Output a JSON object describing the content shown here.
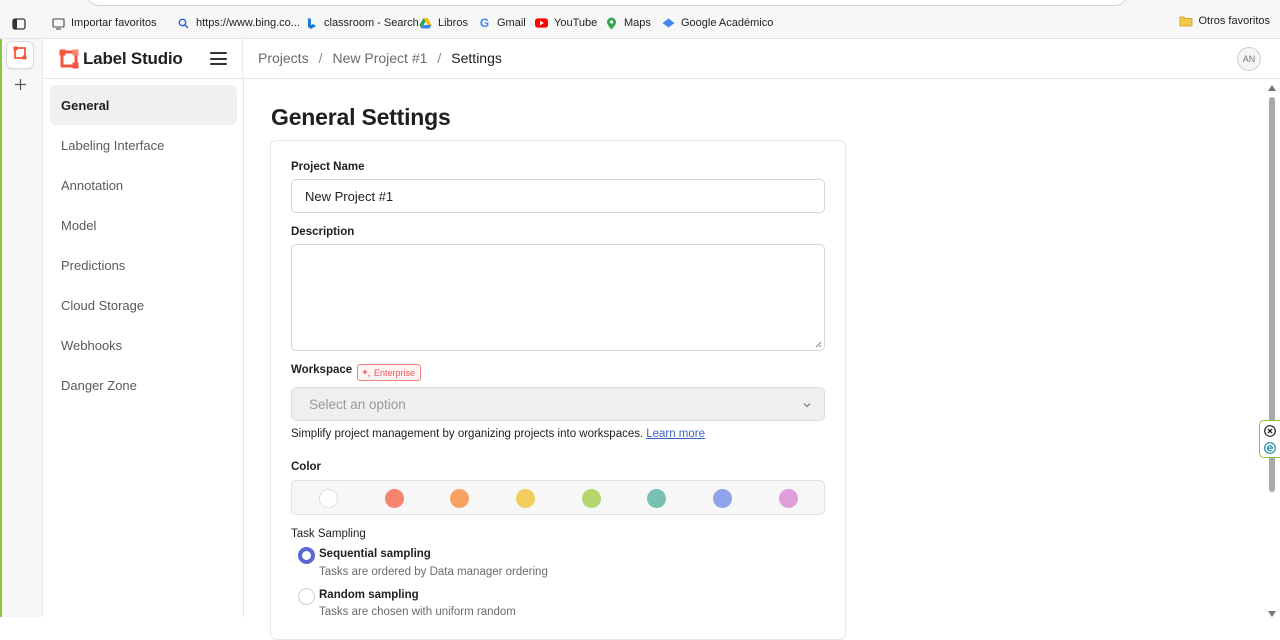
{
  "favorites": {
    "items": [
      {
        "label": "Importar favoritos",
        "icon": "import-icon"
      },
      {
        "label": "https://www.bing.co...",
        "icon": "search-icon"
      },
      {
        "label": "classroom - Search",
        "icon": "bing-icon"
      },
      {
        "label": "Libros",
        "icon": "google-drive-icon"
      },
      {
        "label": "Gmail",
        "icon": "google-icon"
      },
      {
        "label": "YouTube",
        "icon": "youtube-icon"
      },
      {
        "label": "Maps",
        "icon": "maps-pin-icon"
      },
      {
        "label": "Google Académico",
        "icon": "scholar-icon"
      }
    ],
    "other_label": "Otros favoritos"
  },
  "app": {
    "name": "Label Studio",
    "brand_color": "#f5553d"
  },
  "breadcrumb": {
    "items": [
      "Projects",
      "New Project #1",
      "Settings"
    ],
    "separator": "/"
  },
  "user": {
    "initials": "AN"
  },
  "nav": {
    "items": [
      {
        "label": "General",
        "active": true
      },
      {
        "label": "Labeling Interface"
      },
      {
        "label": "Annotation"
      },
      {
        "label": "Model"
      },
      {
        "label": "Predictions"
      },
      {
        "label": "Cloud Storage"
      },
      {
        "label": "Webhooks"
      },
      {
        "label": "Danger Zone"
      }
    ]
  },
  "settings": {
    "title": "General Settings",
    "project_name_label": "Project Name",
    "project_name_value": "New Project #1",
    "description_label": "Description",
    "description_value": "",
    "workspace_label": "Workspace",
    "workspace_badge": "Enterprise",
    "workspace_placeholder": "Select an option",
    "workspace_help": "Simplify project management by organizing projects into workspaces.",
    "workspace_help_link": "Learn more",
    "color_label": "Color",
    "colors": [
      "#ffffff",
      "#f5836e",
      "#f8a262",
      "#f2cd5c",
      "#b5d66d",
      "#77c0b3",
      "#8fa4e8",
      "#df9ed9"
    ],
    "sampling_label": "Task Sampling",
    "sampling_options": [
      {
        "title": "Sequential sampling",
        "desc": "Tasks are ordered by Data manager ordering",
        "checked": true
      },
      {
        "title": "Random sampling",
        "desc": "Tasks are chosen with uniform random",
        "checked": false
      }
    ]
  }
}
